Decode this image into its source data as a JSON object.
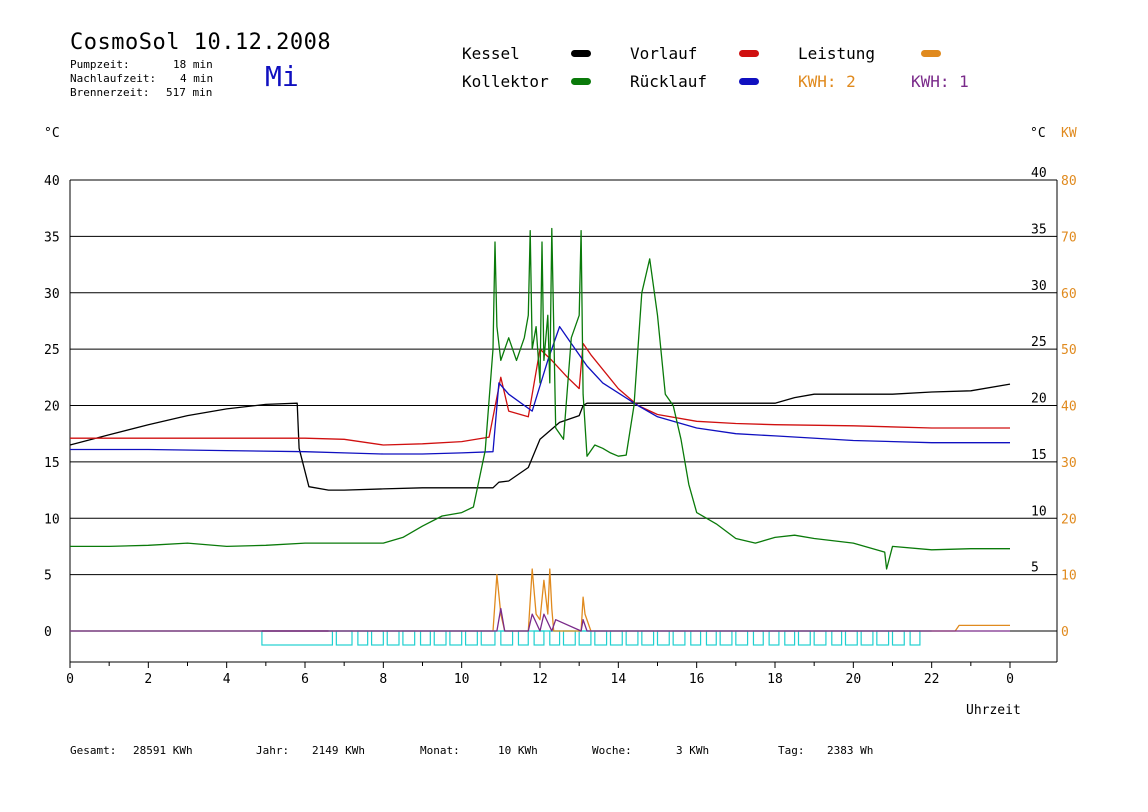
{
  "header": {
    "title": "CosmoSol 10.12.2008",
    "day": "Mi",
    "stats": [
      {
        "label": "Pumpzeit:",
        "value": "18 min"
      },
      {
        "label": "Nachlaufzeit:",
        "value": "4 min"
      },
      {
        "label": "Brennerzeit:",
        "value": "517 min"
      }
    ]
  },
  "legend": {
    "kessel": "Kessel",
    "kollektor": "Kollektor",
    "vorlauf": "Vorlauf",
    "ruecklauf": "Rücklauf",
    "leistung": "Leistung",
    "kwh_a": "KWH: 2",
    "kwh_b": "KWH: 1"
  },
  "axes": {
    "left_unit": "°C",
    "right_unit_c": "°C",
    "right_unit_kw": "KW",
    "x_label": "Uhrzeit"
  },
  "footer": {
    "gesamt_label": "Gesamt:",
    "gesamt_value": "28591 KWh",
    "jahr_label": "Jahr:",
    "jahr_value": "2149 KWh",
    "monat_label": "Monat:",
    "monat_value": "10 KWh",
    "woche_label": "Woche:",
    "woche_value": "3 KWh",
    "tag_label": "Tag:",
    "tag_value": "2383 Wh"
  },
  "colors": {
    "kessel": "#000000",
    "kollektor": "#0a7a0a",
    "vorlauf": "#d01010",
    "ruecklauf": "#1010c0",
    "leistung": "#e08a1e",
    "purple": "#7a2a8a",
    "pump": "#20d0d0"
  },
  "chart_data": {
    "type": "line",
    "title": "CosmoSol 10.12.2008",
    "xlabel": "Uhrzeit",
    "ylabel": "°C",
    "xlim": [
      0,
      24
    ],
    "ylim": [
      0,
      40
    ],
    "y2lim": [
      0,
      80
    ],
    "grid": true,
    "x_ticks": [
      "0",
      "2",
      "4",
      "6",
      "8",
      "10",
      "12",
      "14",
      "16",
      "18",
      "20",
      "22",
      "0"
    ],
    "y_ticks_left": [
      "0",
      "5",
      "10",
      "15",
      "20",
      "25",
      "30",
      "35",
      "40"
    ],
    "y_ticks_right_c": [
      "5",
      "10",
      "15",
      "20",
      "25",
      "30",
      "35",
      "40"
    ],
    "y_ticks_right_kw": [
      "0",
      "10",
      "20",
      "30",
      "40",
      "50",
      "60",
      "70",
      "80"
    ],
    "series": [
      {
        "name": "Kessel",
        "color": "#000000",
        "x": [
          0,
          1,
          2,
          3,
          4,
          5,
          5.8,
          5.85,
          6.1,
          6.6,
          7,
          8,
          9,
          10,
          10.8,
          10.95,
          11.2,
          11.7,
          12,
          12.5,
          13,
          13.1,
          13.2,
          14,
          15,
          16,
          17,
          18,
          18.5,
          19,
          20,
          21,
          22,
          23,
          24
        ],
        "y": [
          16.5,
          17.4,
          18.3,
          19.1,
          19.7,
          20.1,
          20.2,
          16.2,
          12.8,
          12.5,
          12.5,
          12.6,
          12.7,
          12.7,
          12.7,
          13.2,
          13.3,
          14.5,
          17,
          18.5,
          19.1,
          20.0,
          20.2,
          20.2,
          20.2,
          20.2,
          20.2,
          20.2,
          20.7,
          21,
          21,
          21,
          21.2,
          21.3,
          21.9
        ]
      },
      {
        "name": "Vorlauf",
        "color": "#d01010",
        "x": [
          0,
          2,
          4,
          6,
          7,
          8,
          9,
          10,
          10.7,
          11,
          11.2,
          11.7,
          12,
          12.3,
          12.7,
          13,
          13.1,
          13.3,
          14,
          14.5,
          15,
          16,
          17,
          18,
          20,
          22,
          24
        ],
        "y": [
          17.1,
          17.1,
          17.1,
          17.1,
          17.0,
          16.5,
          16.6,
          16.8,
          17.2,
          22.5,
          19.5,
          19.0,
          25,
          24,
          22.5,
          21.5,
          25.5,
          24.5,
          21.5,
          20,
          19.2,
          18.6,
          18.4,
          18.3,
          18.2,
          18.0,
          18.0
        ]
      },
      {
        "name": "Rücklauf",
        "color": "#1010c0",
        "x": [
          0,
          2,
          4,
          6,
          7,
          8,
          9,
          10,
          10.8,
          10.95,
          11.2,
          11.8,
          12.2,
          12.5,
          12.8,
          13,
          13.2,
          13.6,
          14.5,
          15,
          16,
          17,
          18,
          20,
          22,
          24
        ],
        "y": [
          16.1,
          16.1,
          16.0,
          15.9,
          15.8,
          15.7,
          15.7,
          15.8,
          15.9,
          22,
          21,
          19.5,
          24,
          27,
          25.5,
          24.5,
          23.5,
          22,
          20,
          19,
          18,
          17.5,
          17.3,
          16.9,
          16.7,
          16.7
        ]
      },
      {
        "name": "Kollektor",
        "color": "#0a7a0a",
        "x": [
          0,
          1,
          2,
          3,
          4,
          5,
          6,
          7,
          8,
          8.5,
          9,
          9.5,
          10,
          10.3,
          10.6,
          10.8,
          10.85,
          10.9,
          11.0,
          11.2,
          11.4,
          11.6,
          11.7,
          11.75,
          11.8,
          11.9,
          12.0,
          12.05,
          12.1,
          12.2,
          12.25,
          12.3,
          12.4,
          12.6,
          12.8,
          13.0,
          13.05,
          13.1,
          13.2,
          13.4,
          13.6,
          13.8,
          14,
          14.2,
          14.4,
          14.6,
          14.8,
          15,
          15.2,
          15.4,
          15.6,
          15.8,
          16,
          16.5,
          17,
          17.5,
          18,
          18.5,
          19,
          20,
          20.8,
          20.85,
          21,
          22,
          23,
          24
        ],
        "y": [
          7.5,
          7.5,
          7.6,
          7.8,
          7.5,
          7.6,
          7.8,
          7.8,
          7.8,
          8.3,
          9.3,
          10.2,
          10.5,
          11,
          16,
          25,
          34.5,
          27,
          24,
          26,
          24,
          26,
          28,
          35.5,
          25,
          27,
          22,
          34.5,
          24,
          28,
          22,
          35.7,
          18,
          17,
          26,
          28,
          35.5,
          21,
          15.5,
          16.5,
          16.2,
          15.8,
          15.5,
          15.6,
          20,
          30,
          33,
          28,
          21,
          20,
          17,
          13,
          10.5,
          9.5,
          8.2,
          7.8,
          8.3,
          8.5,
          8.2,
          7.8,
          7,
          5.5,
          7.5,
          7.2,
          7.3,
          7.3
        ]
      },
      {
        "name": "Leistung",
        "unit": "KW",
        "color": "#e08a1e",
        "x": [
          0,
          10.8,
          10.9,
          11.0,
          11.1,
          11.7,
          11.8,
          11.9,
          12.0,
          12.1,
          12.2,
          12.25,
          12.3,
          12.35,
          12.5,
          13.05,
          13.1,
          13.15,
          13.3,
          22.6,
          22.7,
          24
        ],
        "y": [
          0,
          0,
          10,
          3,
          0,
          0,
          11,
          3,
          2,
          9,
          3,
          11,
          4,
          0,
          0,
          0,
          6,
          3,
          0,
          0,
          1,
          1
        ]
      },
      {
        "name": "KWH: 1",
        "unit": "KW",
        "color": "#7a2a8a",
        "x": [
          0,
          4.9,
          4.9,
          6.6,
          6.6,
          10.9,
          11.0,
          11.1,
          11.7,
          11.8,
          12.0,
          12.1,
          12.3,
          12.4,
          13.05,
          13.1,
          13.2,
          24
        ],
        "y": [
          0,
          0,
          0,
          0,
          0,
          0,
          4,
          0,
          0,
          3,
          0,
          3,
          0,
          2,
          0,
          2,
          0,
          0
        ]
      }
    ],
    "pump_cycles": {
      "name": "Pumpe",
      "color": "#20d0d0",
      "intervals": [
        [
          4.9,
          6.7
        ],
        [
          6.8,
          7.2
        ],
        [
          7.35,
          7.6
        ],
        [
          7.7,
          8.0
        ],
        [
          8.1,
          8.4
        ],
        [
          8.5,
          8.8
        ],
        [
          8.95,
          9.2
        ],
        [
          9.3,
          9.6
        ],
        [
          9.7,
          10.0
        ],
        [
          10.1,
          10.4
        ],
        [
          10.5,
          10.85
        ],
        [
          11.0,
          11.3
        ],
        [
          11.45,
          11.7
        ],
        [
          11.85,
          12.1
        ],
        [
          12.25,
          12.5
        ],
        [
          12.6,
          12.9
        ],
        [
          13.0,
          13.3
        ],
        [
          13.4,
          13.7
        ],
        [
          13.8,
          14.1
        ],
        [
          14.2,
          14.5
        ],
        [
          14.6,
          14.9
        ],
        [
          15.0,
          15.3
        ],
        [
          15.4,
          15.7
        ],
        [
          15.85,
          16.1
        ],
        [
          16.25,
          16.5
        ],
        [
          16.6,
          16.9
        ],
        [
          17.0,
          17.3
        ],
        [
          17.45,
          17.7
        ],
        [
          17.85,
          18.1
        ],
        [
          18.25,
          18.5
        ],
        [
          18.6,
          18.9
        ],
        [
          19.0,
          19.3
        ],
        [
          19.45,
          19.7
        ],
        [
          19.8,
          20.1
        ],
        [
          20.2,
          20.5
        ],
        [
          20.6,
          20.9
        ],
        [
          21.0,
          21.3
        ],
        [
          21.45,
          21.7
        ]
      ]
    }
  }
}
